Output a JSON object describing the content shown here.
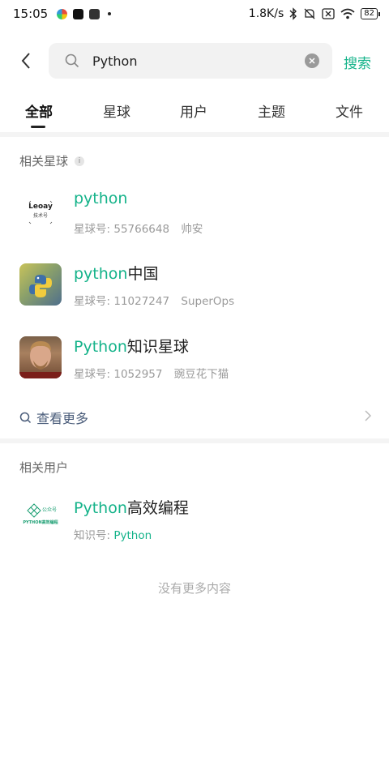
{
  "status_bar": {
    "time": "15:05",
    "net_speed": "1.8K/s",
    "battery": "82"
  },
  "search": {
    "query": "Python",
    "button_label": "搜索"
  },
  "tabs": [
    {
      "label": "全部",
      "active": true
    },
    {
      "label": "星球",
      "active": false
    },
    {
      "label": "用户",
      "active": false
    },
    {
      "label": "主题",
      "active": false
    },
    {
      "label": "文件",
      "active": false
    }
  ],
  "related_planets": {
    "title": "相关星球",
    "info_icon": "info-icon",
    "items": [
      {
        "title_highlight": "python",
        "title_rest": "",
        "id_label": "星球号:",
        "id": "55766648",
        "owner": "帅安"
      },
      {
        "title_highlight": "python",
        "title_rest": "中国",
        "id_label": "星球号:",
        "id": "11027247",
        "owner": "SuperOps"
      },
      {
        "title_highlight": "Python",
        "title_rest": "知识星球",
        "id_label": "星球号:",
        "id": "1052957",
        "owner": "豌豆花下猫"
      }
    ],
    "see_more": "查看更多"
  },
  "related_users": {
    "title": "相关用户",
    "items": [
      {
        "title_highlight": "Python",
        "title_rest": "高效编程",
        "id_label": "知识号:",
        "id": "Python"
      }
    ]
  },
  "footer": {
    "no_more": "没有更多内容"
  },
  "logo_text": {
    "leoay_name": "Leoay",
    "leoay_sub": "技术号",
    "gzh_top": "公众号",
    "gzh_bottom": "PYTHON高效编程"
  },
  "colors": {
    "accent": "#15b38a",
    "link": "#4a5c7a"
  }
}
